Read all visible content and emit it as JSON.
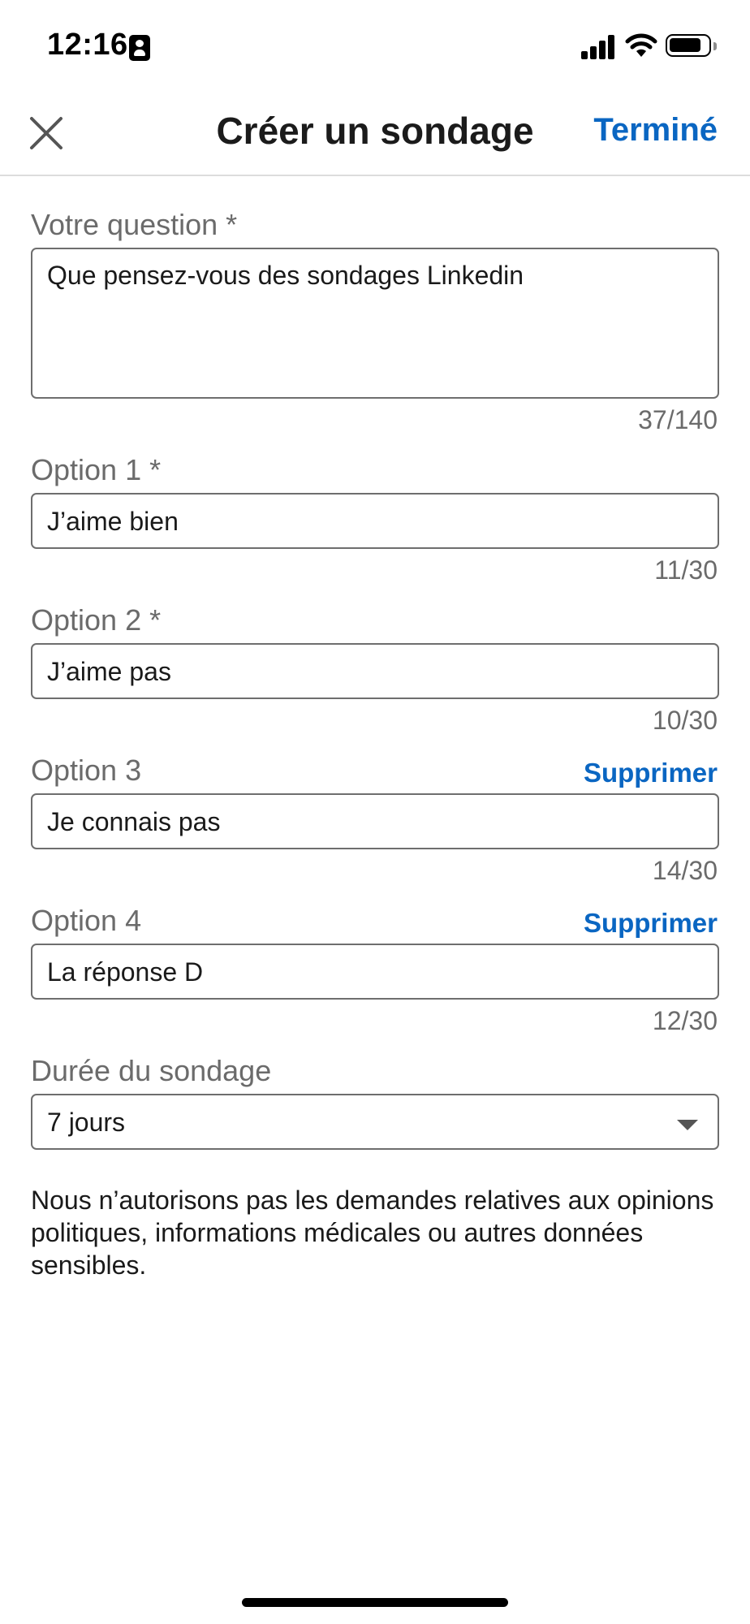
{
  "status_bar": {
    "time": "12:16"
  },
  "header": {
    "title": "Créer un sondage",
    "done_label": "Terminé"
  },
  "form": {
    "question": {
      "label": "Votre question *",
      "value": "Que pensez-vous des sondages Linkedin",
      "counter": "37/140"
    },
    "options": [
      {
        "label": "Option 1 *",
        "value": "J’aime bien",
        "counter": "11/30"
      },
      {
        "label": "Option 2 *",
        "value": "J’aime pas",
        "counter": "10/30"
      },
      {
        "label": "Option 3",
        "value": "Je connais pas",
        "counter": "14/30",
        "remove_label": "Supprimer"
      },
      {
        "label": "Option 4",
        "value": "La réponse D",
        "counter": "12/30",
        "remove_label": "Supprimer"
      }
    ],
    "duration": {
      "label": "Durée du sondage",
      "value": "7 jours"
    },
    "notice": "Nous n’autorisons pas les demandes relatives aux opinions politiques, informations médicales ou autres données sensibles."
  },
  "colors": {
    "accent": "#0a66c2",
    "label_gray": "#6b6b6b",
    "border": "#6e6e6e"
  },
  "icons": {
    "close": "close-icon",
    "dropdown": "chevron-down-icon",
    "wifi": "wifi-icon",
    "signal": "signal-icon",
    "battery": "battery-icon",
    "badge": "id-badge-icon"
  }
}
